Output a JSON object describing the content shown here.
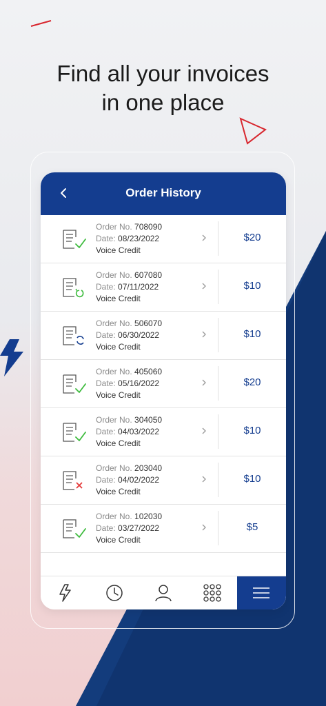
{
  "headline": {
    "line1": "Find all your invoices",
    "line2": "in one place"
  },
  "header": {
    "title": "Order History",
    "back_icon": "chevron-left-icon"
  },
  "labels": {
    "order_no": "Order No.",
    "date": "Date:"
  },
  "orders": [
    {
      "order_no": "708090",
      "date": "08/23/2022",
      "type": "Voice Credit",
      "amount": "$20",
      "status": "success"
    },
    {
      "order_no": "607080",
      "date": "07/11/2022",
      "type": "Voice Credit",
      "amount": "$10",
      "status": "pending"
    },
    {
      "order_no": "506070",
      "date": "06/30/2022",
      "type": "Voice Credit",
      "amount": "$10",
      "status": "processing"
    },
    {
      "order_no": "405060",
      "date": "05/16/2022",
      "type": "Voice Credit",
      "amount": "$20",
      "status": "success"
    },
    {
      "order_no": "304050",
      "date": "04/03/2022",
      "type": "Voice Credit",
      "amount": "$10",
      "status": "success"
    },
    {
      "order_no": "203040",
      "date": "04/02/2022",
      "type": "Voice Credit",
      "amount": "$10",
      "status": "failed"
    },
    {
      "order_no": "102030",
      "date": "03/27/2022",
      "type": "Voice Credit",
      "amount": "$5",
      "status": "success"
    }
  ],
  "tabs": [
    {
      "icon": "lightning-icon",
      "active": false
    },
    {
      "icon": "clock-icon",
      "active": false
    },
    {
      "icon": "user-icon",
      "active": false
    },
    {
      "icon": "keypad-icon",
      "active": false
    },
    {
      "icon": "menu-icon",
      "active": true
    }
  ],
  "colors": {
    "brand_navy": "#143d8f",
    "accent_red": "#d8262e",
    "success_green": "#3dbb3d",
    "fail_red": "#e53a3a"
  }
}
